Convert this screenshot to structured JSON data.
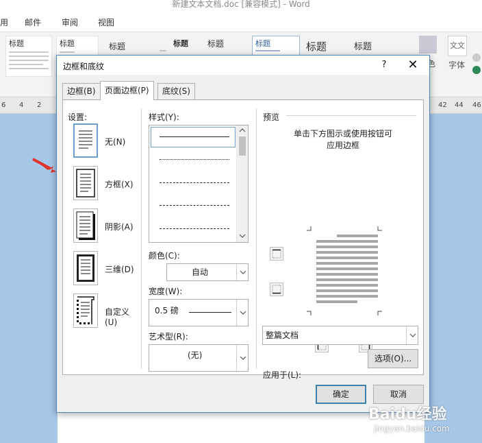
{
  "word": {
    "title": "新建文本文档.doc [兼容模式] - Word",
    "tabs": [
      "用",
      "邮件",
      "审阅",
      "视图"
    ],
    "style_gallery": [
      "标题",
      "标题",
      "标题",
      "标题",
      "标题",
      "标题",
      "标题",
      "标题"
    ],
    "font_group_label": "字体",
    "wen_zi_label": "文文",
    "color_label": "色",
    "ruler_left": [
      "6",
      "4",
      "2"
    ],
    "ruler_right": [
      "42",
      "44",
      "46"
    ]
  },
  "dialog": {
    "title": "边框和底纹",
    "help": "?",
    "close": "✕",
    "tabs": [
      {
        "label": "边框(B)",
        "active": false
      },
      {
        "label": "页面边框(P)",
        "active": true
      },
      {
        "label": "底纹(S)",
        "active": false
      }
    ],
    "settings": {
      "label": "设置:",
      "items": [
        {
          "label": "无(N)",
          "icon": "none-border-icon",
          "selected": true
        },
        {
          "label": "方框(X)",
          "icon": "box-border-icon",
          "selected": false
        },
        {
          "label": "阴影(A)",
          "icon": "shadow-border-icon",
          "selected": false
        },
        {
          "label": "三维(D)",
          "icon": "3d-border-icon",
          "selected": false
        },
        {
          "label": "自定义(U)",
          "icon": "custom-border-icon",
          "selected": false
        }
      ]
    },
    "style": {
      "label": "样式(Y):",
      "lines": [
        "solid",
        "dotted",
        "dashed-small",
        "dashed",
        "dash-dot"
      ]
    },
    "color": {
      "label": "颜色(C):",
      "value": "自动"
    },
    "width": {
      "label": "宽度(W):",
      "value": "0.5 磅"
    },
    "art": {
      "label": "艺术型(R):",
      "value": "(无)"
    },
    "preview": {
      "label": "预览",
      "hint_line1": "单击下方图示或使用按钮可",
      "hint_line2": "应用边框"
    },
    "apply_to": {
      "label": "应用于(L):",
      "value": "整篇文档"
    },
    "options_button": "选项(O)...",
    "ok_button": "确定",
    "cancel_button": "取消"
  },
  "watermark": {
    "brand": "Baidu经验",
    "url": "jingyan.baidu.com"
  }
}
